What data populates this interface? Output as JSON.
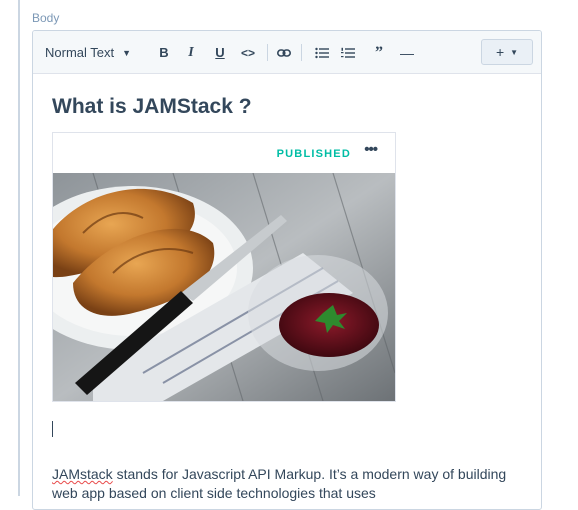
{
  "field": {
    "label": "Body"
  },
  "toolbar": {
    "style_select": "Normal Text",
    "bold": "B",
    "italic": "I",
    "underline": "U",
    "code": "<>",
    "blockquote": "”",
    "hr": "—",
    "insert": "+"
  },
  "content": {
    "heading": "What is JAMStack ?",
    "image_card": {
      "status": "PUBLISHED",
      "more": "•••"
    },
    "paragraph_word": "JAMstack",
    "paragraph_rest": " stands for Javascript API Markup. It’s a modern way of building web app based on client side technologies that uses"
  },
  "colors": {
    "accent_published": "#00bda5",
    "text": "#33475b",
    "border": "#cbd6e2",
    "toolbar_bg": "#f5f8fa"
  },
  "icons": [
    "chevron-down-icon",
    "link-icon",
    "bullet-list-icon",
    "numbered-list-icon",
    "blockquote-icon",
    "horizontal-rule-icon",
    "more-icon"
  ]
}
